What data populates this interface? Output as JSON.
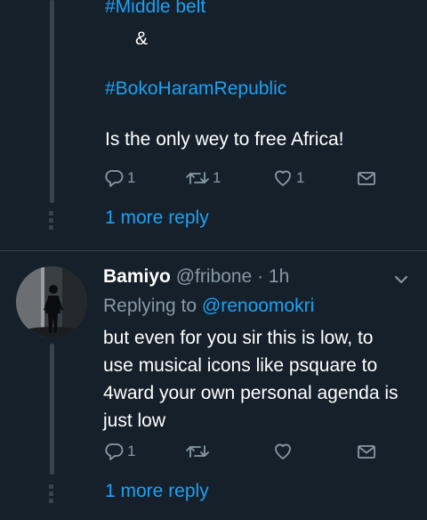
{
  "tweet_top": {
    "line_hashtag_1": "#Middle belt",
    "line_amp": "&",
    "line_hashtag_2": "#BokoHaramRepublic",
    "line_text": "Is the only wey to free Africa!",
    "actions": {
      "reply_count": "1",
      "retweet_count": "1",
      "like_count": "1"
    },
    "more_reply": "1 more reply"
  },
  "tweet_bottom": {
    "name": "Bamiyo",
    "handle": "@fribone",
    "separator": "·",
    "time": "1h",
    "replying_prefix": "Replying to",
    "replying_to": "@renoomokri",
    "body_lines": [
      "but even for you sir this is low, to",
      "use musical icons like psquare to",
      "4ward your own personal agenda is",
      "just low"
    ],
    "actions": {
      "reply_count": "1",
      "retweet_count": "",
      "like_count": ""
    },
    "more_reply": "1 more reply"
  },
  "colors": {
    "background": "#15202b",
    "accent": "#1da1f2",
    "secondary_text": "#8899a6",
    "divider": "#38444d"
  },
  "icons": [
    "reply-icon",
    "retweet-icon",
    "like-icon",
    "share-icon",
    "chevron-down-icon"
  ]
}
